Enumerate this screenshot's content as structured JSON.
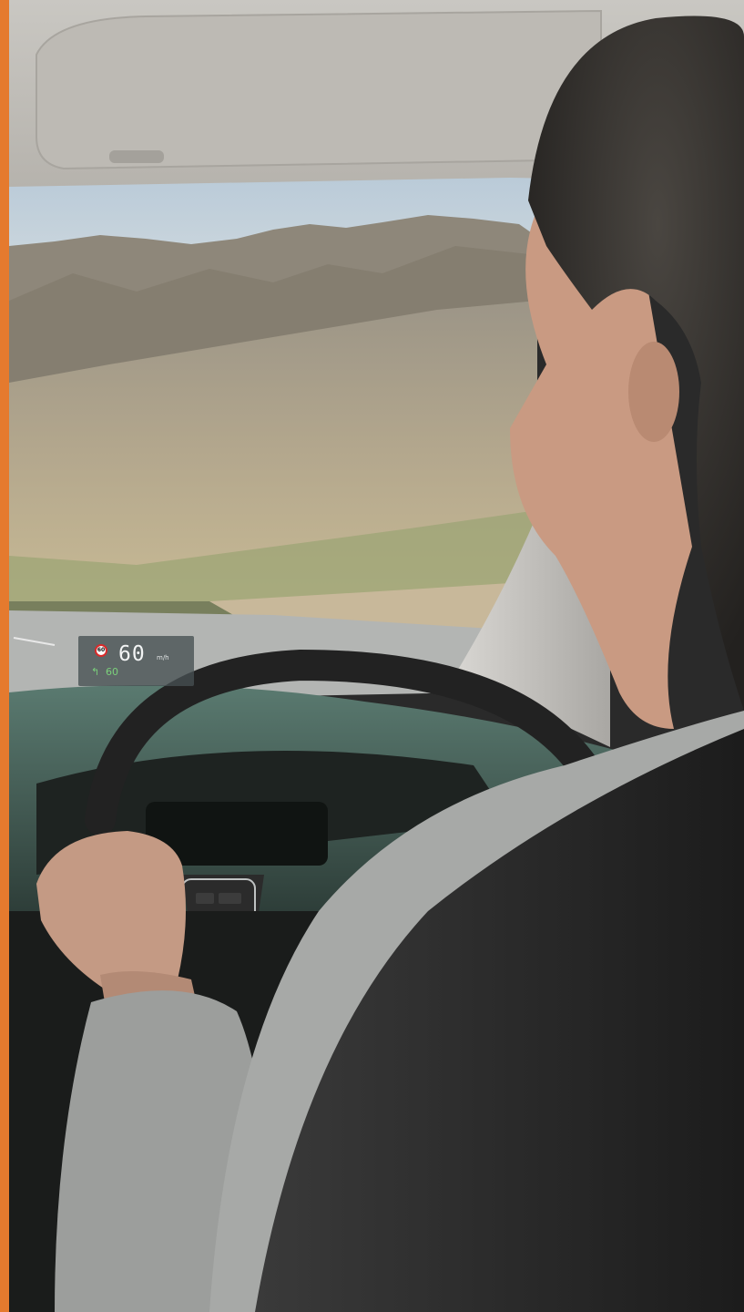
{
  "image": {
    "description_role": "photo",
    "accent_color": "#e57a2e"
  },
  "hud": {
    "sign_value": "60",
    "speed": "60",
    "unit": "m/h",
    "cruise_arrow": "↰",
    "cruise_limit": "60",
    "speed_color": "#f2f4f4",
    "cruise_color": "#7bd17b",
    "sign_border_color": "#d92a2a"
  }
}
